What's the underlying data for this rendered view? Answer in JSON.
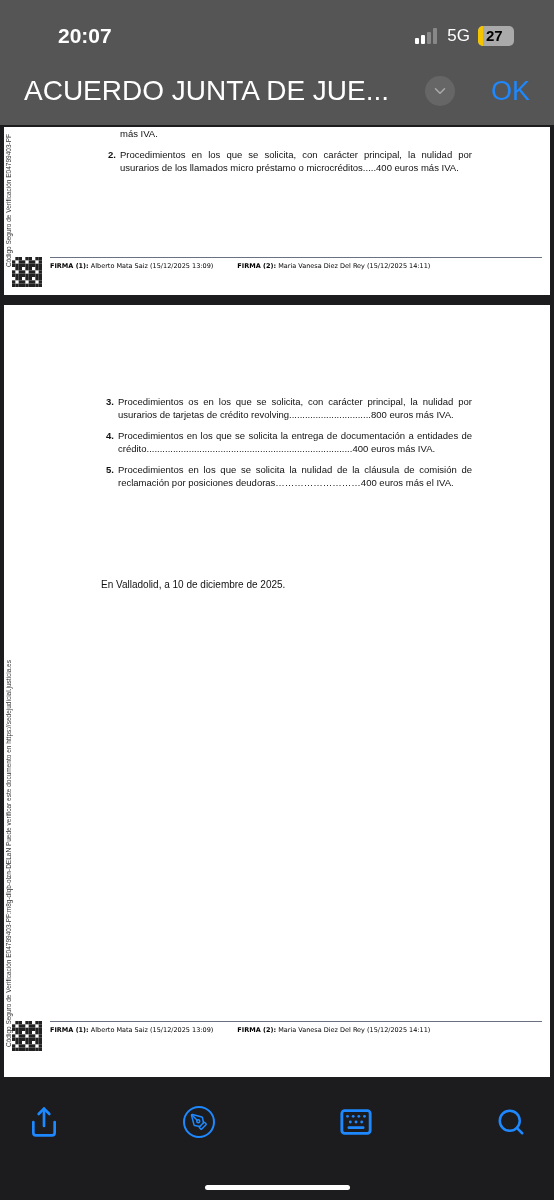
{
  "status_bar": {
    "time": "20:07",
    "network": "5G",
    "battery": "27"
  },
  "header": {
    "title": "ACUERDO JUNTA DE JUE...",
    "done": "OK"
  },
  "pages": [
    {
      "side_text": "Código Seguro de Verificación E04799403-PF",
      "items": [
        {
          "text": "más IVA."
        },
        {
          "number": "2.",
          "text": "Procedimientos en los que se solicita, con carácter principal, la nulidad por usurarios de los llamados micro préstamo o microcréditos.....400 euros más IVA."
        }
      ],
      "signatures": [
        {
          "label": "FIRMA (1):",
          "value": "Alberto Mata Saiz (15/12/2025 13:09)"
        },
        {
          "label": "FIRMA (2):",
          "value": "Maria Vanesa Diez Del Rey (15/12/2025 14:11)"
        }
      ]
    },
    {
      "side_text": "Código Seguro de Verificación E04799403-PF:m8g-dlqb-olzn-DELaN   Puede verificar este documento en https://sedejudicial.justicia.es",
      "items": [
        {
          "number": "3.",
          "text": "Procedimientos os en los que se solicita, con carácter principal, la nulidad por usurarios de tarjetas de crédito revolving...............................800 euros más IVA."
        },
        {
          "number": "4.",
          "text": "Procedimientos en los que se solicita la entrega de documentación a entidades de crédito..............................................................................400 euros más IVA."
        },
        {
          "number": "5.",
          "text": "Procedimientos en los que se solicita la nulidad de la cláusula de comisión de reclamación por posiciones deudoras………………………400 euros más el IVA."
        }
      ],
      "closing": "En Valladolid, a 10 de diciembre de 2025.",
      "signatures": [
        {
          "label": "FIRMA (1):",
          "value": "Alberto Mata Saiz (15/12/2025 13:09)"
        },
        {
          "label": "FIRMA (2):",
          "value": "Maria Vanesa Diez Del Rey (15/12/2025 14:11)"
        }
      ]
    }
  ]
}
